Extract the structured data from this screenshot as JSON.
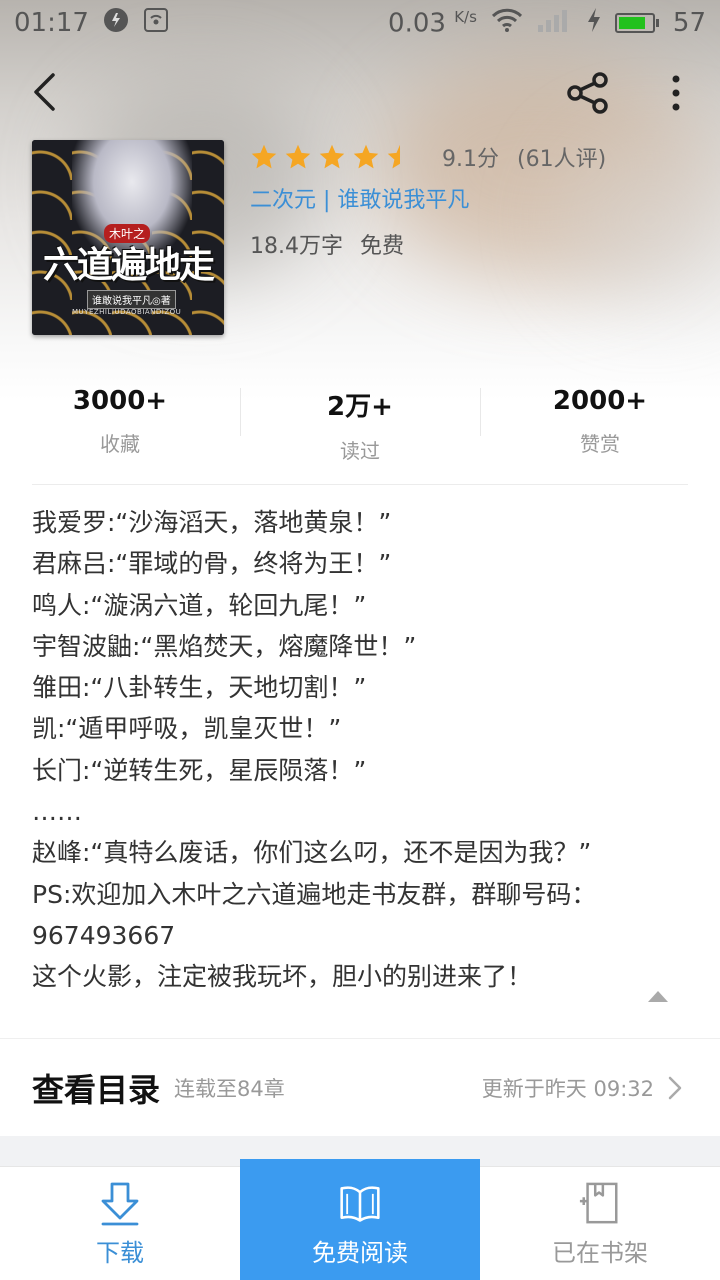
{
  "status_bar": {
    "time": "01:17",
    "net_speed": "0.03",
    "net_unit": "K/s",
    "battery": "57"
  },
  "book": {
    "cover_sub_title": "木叶之",
    "cover_title": "六道遍地走",
    "cover_author": "谁敢说我平凡◎著",
    "cover_pinyin": "MUYEZHILIUDAOBIANDIZOU",
    "rating_stars": 4.5,
    "score": "9.1分",
    "reviews": "(61人评)",
    "tags": "二次元 | 谁敢说我平凡",
    "word_count": "18.4万字",
    "price": "免费"
  },
  "stats": [
    {
      "value": "3000+",
      "label": "收藏"
    },
    {
      "value": "2万+",
      "label": "读过"
    },
    {
      "value": "2000+",
      "label": "赞赏"
    }
  ],
  "intro": {
    "lines": [
      "我爱罗:“沙海滔天，落地黄泉！”",
      "君麻吕:“罪域的骨，终将为王！”",
      "鸣人:“漩涡六道，轮回九尾！”",
      "宇智波鼬:“黑焰焚天，熔魔降世！”",
      "雏田:“八卦转生，天地切割！”",
      "凯:“遁甲呼吸，凯皇灭世！”",
      "长门:“逆转生死，星辰陨落！”",
      "……",
      "赵峰:“真特么废话，你们这么叼，还不是因为我？”",
      "PS:欢迎加入木叶之六道遍地走书友群，群聊号码：",
      "967493667",
      "这个火影，注定被我玩坏，胆小的别进来了！"
    ]
  },
  "catalog": {
    "title": "查看目录",
    "status": "连载至84章",
    "updated": "更新于昨天 09:32"
  },
  "bottom_bar": {
    "download": "下载",
    "read": "免费阅读",
    "shelf": "已在书架"
  },
  "colors": {
    "accent": "#3b9bf0",
    "link": "#3b8fd6",
    "star": "#f5a623"
  }
}
